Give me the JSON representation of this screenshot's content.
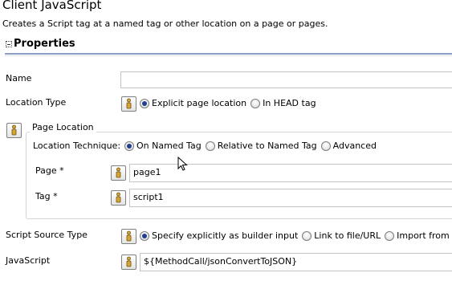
{
  "header": {
    "title": "Client JavaScript",
    "subtitle": "Creates a Script tag at a named tag or other location on a page or pages."
  },
  "properties": {
    "section_label": "Properties"
  },
  "name_field": {
    "label": "Name",
    "value": ""
  },
  "location_type": {
    "label": "Location Type",
    "options": [
      "Explicit page location",
      "In HEAD tag"
    ],
    "selected": "Explicit page location"
  },
  "page_location": {
    "group_label": "Page Location",
    "technique_label": "Location Technique:",
    "technique_options": [
      "On Named Tag",
      "Relative to Named Tag",
      "Advanced"
    ],
    "technique_selected": "On Named Tag",
    "page_label": "Page *",
    "page_value": "page1",
    "tag_label": "Tag *",
    "tag_value": "script1"
  },
  "script_source": {
    "label": "Script Source Type",
    "options": [
      "Specify explicitly as builder input",
      "Link to file/URL",
      "Import from fil"
    ],
    "selected": "Specify explicitly as builder input"
  },
  "javascript": {
    "label": "JavaScript",
    "value": "${MethodCall/jsonConvertToJSON}"
  },
  "icons": {
    "picker": "builder-input-picker-icon",
    "cursor": "mouse-cursor-icon",
    "collapse": "section-collapse-icon"
  },
  "colors": {
    "section_rule": "#8f9cc3",
    "radio_dot": "#1f3f8f",
    "picker_figure": "#d6a532"
  }
}
